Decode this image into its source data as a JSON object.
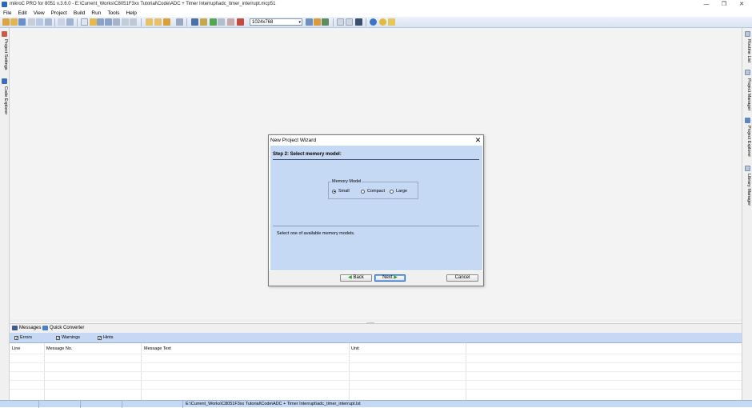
{
  "window": {
    "title": "mikroC PRO for 8051 v.3.6.0 - E:\\Current_Works\\C8051F3xx Tutorial\\Code\\ADC + Timer Interrupt\\adc_timer_interrupt.mcp51",
    "minimize_glyph": "—",
    "restore_glyph": "❐",
    "close_glyph": "✕"
  },
  "menu": {
    "items": [
      "File",
      "Edit",
      "View",
      "Project",
      "Build",
      "Run",
      "Tools",
      "Help"
    ]
  },
  "toolbar": {
    "resolution": "1024x768",
    "caret": "▾"
  },
  "left_panel": {
    "tabs": [
      "Project Settings",
      "Code Explorer"
    ]
  },
  "right_panel": {
    "tabs": [
      "Routine List",
      "Project Manager",
      "Project Explorer",
      "Library Manager"
    ]
  },
  "dialog": {
    "title": "New Project Wizard",
    "close_glyph": "✕",
    "step": "Step 2: Select memory model:",
    "group_label": "Memory Model",
    "options": [
      {
        "label": "Small",
        "selected": true
      },
      {
        "label": "Compact",
        "selected": false
      },
      {
        "label": "Large",
        "selected": false
      }
    ],
    "description": "Select one of  available memory models.",
    "back_label": "Back",
    "next_label": "Next",
    "cancel_label": "Cancel",
    "back_glyph": "◀",
    "next_glyph": "▶"
  },
  "splitter": {
    "grip": "..........."
  },
  "messages": {
    "tabs": [
      "Messages",
      "Quick Converter"
    ],
    "filters": [
      {
        "label": "Errors",
        "checked": true
      },
      {
        "label": "Warnings",
        "checked": true
      },
      {
        "label": "Hints",
        "checked": true
      }
    ],
    "check_glyph": "✓",
    "columns": [
      "Line",
      "Message No.",
      "Message Text",
      "Unit"
    ]
  },
  "statusbar": {
    "path": "E:\\Current_Works\\C8051F3xx Tutorial\\Code\\ADC + Timer Interrupt\\adc_timer_interrupt.lst"
  },
  "colors": {
    "accent": "#2d6cc0",
    "panel_blue": "#c5d8f4",
    "workspace": "#f3f3f3"
  }
}
